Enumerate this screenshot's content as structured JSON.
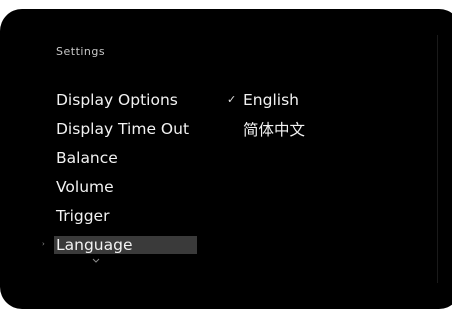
{
  "header": {
    "title": "Settings"
  },
  "menu": {
    "items": [
      {
        "label": "Display Options"
      },
      {
        "label": "Display Time Out"
      },
      {
        "label": "Balance"
      },
      {
        "label": "Volume"
      },
      {
        "label": "Trigger"
      },
      {
        "label": "Language",
        "selected": true
      }
    ],
    "pointer_glyph": "›"
  },
  "options": {
    "items": [
      {
        "label": "English",
        "checked": true,
        "check_glyph": "✓"
      },
      {
        "label": "简体中文",
        "checked": false,
        "check_glyph": ""
      }
    ]
  },
  "colors": {
    "screen_background": "#000000",
    "text": "#f2f2f2",
    "header_text": "#c8c8c8",
    "selection_highlight": "#3a3a3a"
  },
  "icons": {
    "scroll_indicator": "chevron-down-icon",
    "check_mark": "check-icon"
  }
}
